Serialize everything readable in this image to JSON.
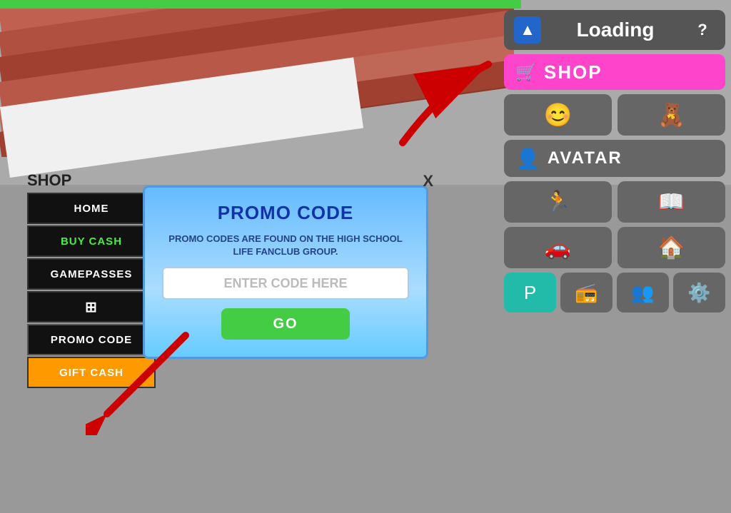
{
  "game": {
    "bg_color": "#999999"
  },
  "topRight": {
    "loading_label": "Loading",
    "question_label": "?",
    "shop_label": "SHOP",
    "avatar_label": "AVATAR",
    "loading_icon": "▲"
  },
  "sidebar": {
    "title": "SHOP",
    "close": "X",
    "items": [
      {
        "id": "home",
        "label": "HOME",
        "style": "normal"
      },
      {
        "id": "buy-cash",
        "label": "BUY CASH",
        "style": "green-text"
      },
      {
        "id": "gamepasses",
        "label": "GAMEPASSES",
        "style": "normal"
      },
      {
        "id": "icon",
        "label": "⊞",
        "style": "icon"
      },
      {
        "id": "promo-code",
        "label": "PROMO CODE",
        "style": "normal"
      },
      {
        "id": "gift-cash",
        "label": "GIFT CASH",
        "style": "gift"
      }
    ]
  },
  "promoPanel": {
    "title": "PROMO CODE",
    "description": "PROMO CODES ARE FOUND ON THE HIGH SCHOOL LIFE FANCLUB GROUP.",
    "input_placeholder": "ENTER CODE HERE",
    "go_label": "GO"
  },
  "icons": {
    "smiley": "😊",
    "bear": "🧸",
    "avatar": "👤",
    "run": "🏃",
    "book": "📖",
    "car": "🚗",
    "house": "🏠",
    "p": "P",
    "radio": "📻",
    "people": "👥",
    "gear": "⚙️",
    "cart": "🛒"
  }
}
